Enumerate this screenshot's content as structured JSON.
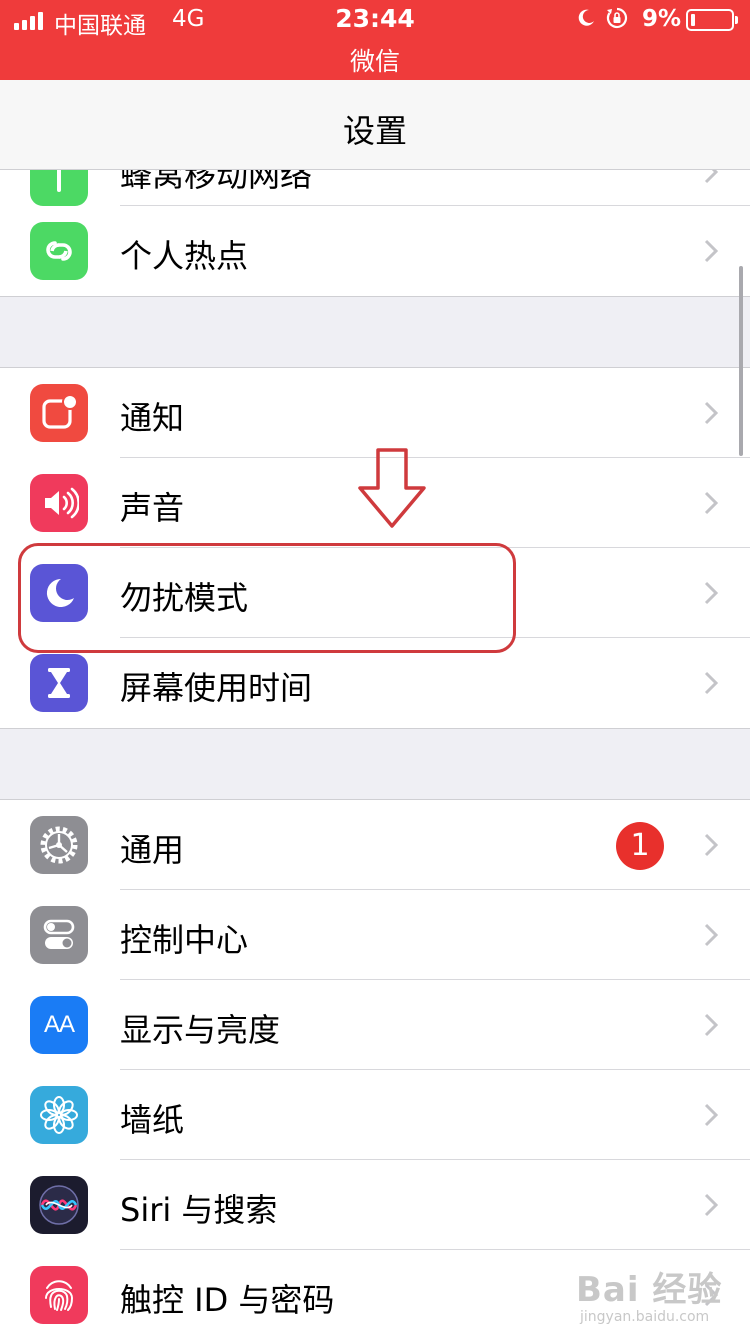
{
  "status_bar": {
    "carrier": "中国联通",
    "network": "4G",
    "time": "23:44",
    "return_app": "微信",
    "battery_percent": "9%",
    "battery_level": 0.09,
    "background_color": "#ef3b3b"
  },
  "nav": {
    "title": "设置"
  },
  "groups": [
    {
      "rows": [
        {
          "label": "蜂窝移动网络",
          "icon": "cellular-icon",
          "color": "#4cd964",
          "partial": true
        },
        {
          "label": "个人热点",
          "icon": "hotspot-icon",
          "color": "#4cd964"
        }
      ]
    },
    {
      "rows": [
        {
          "label": "通知",
          "icon": "notifications-icon",
          "color": "#f04a40"
        },
        {
          "label": "声音",
          "icon": "speaker-icon",
          "color": "#f03a5c"
        },
        {
          "label": "勿扰模式",
          "icon": "moon-icon",
          "color": "#5a55d6"
        },
        {
          "label": "屏幕使用时间",
          "icon": "hourglass-icon",
          "color": "#5a55d6"
        }
      ]
    },
    {
      "rows": [
        {
          "label": "通用",
          "icon": "gear-icon",
          "color": "#8e8e93",
          "badge": "1"
        },
        {
          "label": "控制中心",
          "icon": "toggles-icon",
          "color": "#8e8e93"
        },
        {
          "label": "显示与亮度",
          "icon": "text-size-icon",
          "color": "#1a7cf5",
          "icon_text": "AA"
        },
        {
          "label": "墙纸",
          "icon": "flower-icon",
          "color": "#36aadc"
        },
        {
          "label": "Siri 与搜索",
          "icon": "siri-icon",
          "color": "#1c1c2e"
        },
        {
          "label": "触控 ID 与密码",
          "icon": "fingerprint-icon",
          "color": "#f03a5c"
        }
      ]
    }
  ],
  "annotation": {
    "highlight_color": "#cf3a3d",
    "arrow_icon": "down-arrow-icon"
  },
  "watermark": {
    "mark": "Bai 经验",
    "sub": "jingyan.baidu.com"
  }
}
